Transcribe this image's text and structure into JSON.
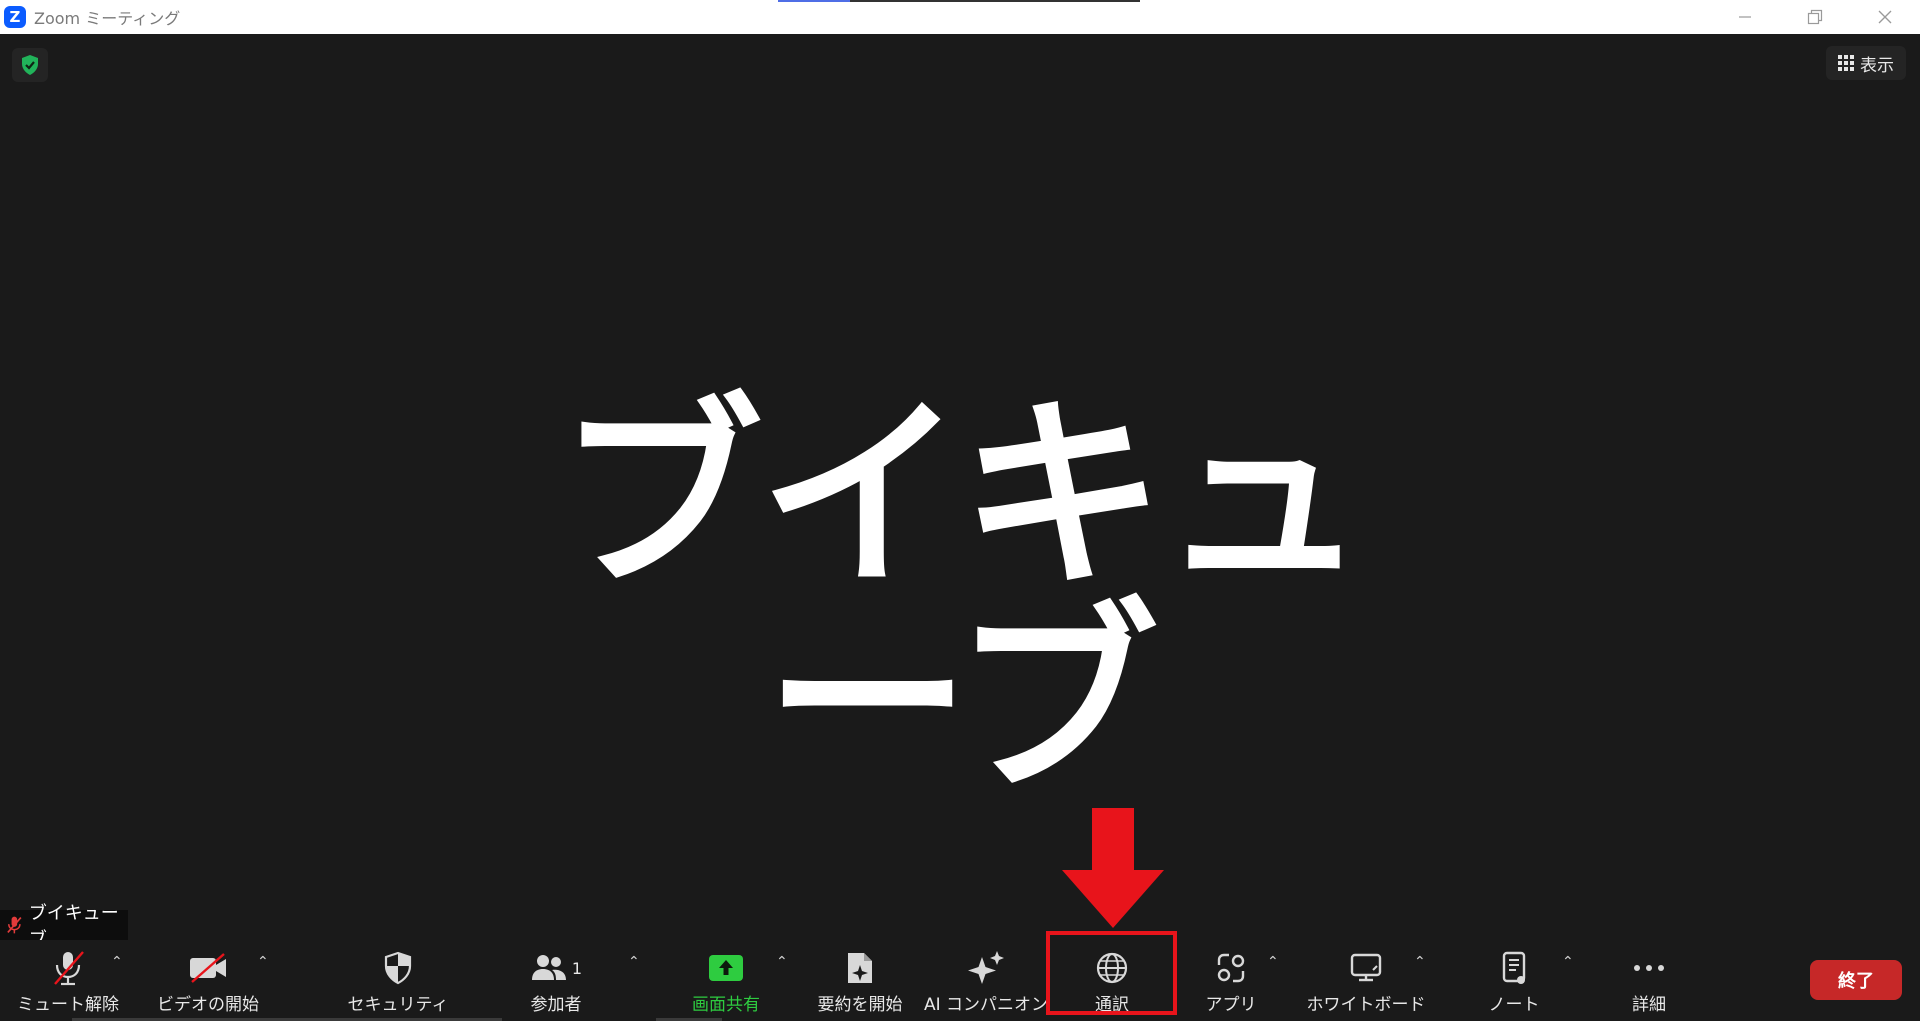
{
  "window": {
    "title": "Zoom ミーティング",
    "logo_letter": "Z"
  },
  "meeting": {
    "view_label": "表示",
    "participant_display_name": "ブイキューブ",
    "name_tag": "ブイキューブ"
  },
  "toolbar": {
    "mute": {
      "label": "ミュート解除",
      "icon": "microphone-muted-icon"
    },
    "video": {
      "label": "ビデオの開始",
      "icon": "video-off-icon"
    },
    "security": {
      "label": "セキュリティ",
      "icon": "shield-icon"
    },
    "participants": {
      "label": "参加者",
      "count": "1",
      "icon": "participants-icon"
    },
    "share": {
      "label": "画面共有",
      "icon": "share-screen-icon",
      "color": "#2ecc40"
    },
    "summary": {
      "label": "要約を開始",
      "icon": "summary-document-icon"
    },
    "ai_companion": {
      "label": "AI コンパニオン",
      "icon": "sparkle-icon"
    },
    "interpretation": {
      "label": "通訳",
      "icon": "globe-icon"
    },
    "apps": {
      "label": "アプリ",
      "icon": "apps-icon"
    },
    "whiteboard": {
      "label": "ホワイトボード",
      "icon": "whiteboard-icon"
    },
    "notes": {
      "label": "ノート",
      "icon": "notes-icon"
    },
    "more": {
      "label": "詳細",
      "icon": "more-dots-icon"
    },
    "end": {
      "label": "終了",
      "color": "#c62828"
    }
  },
  "annotation": {
    "highlight_color": "#e8141b"
  }
}
